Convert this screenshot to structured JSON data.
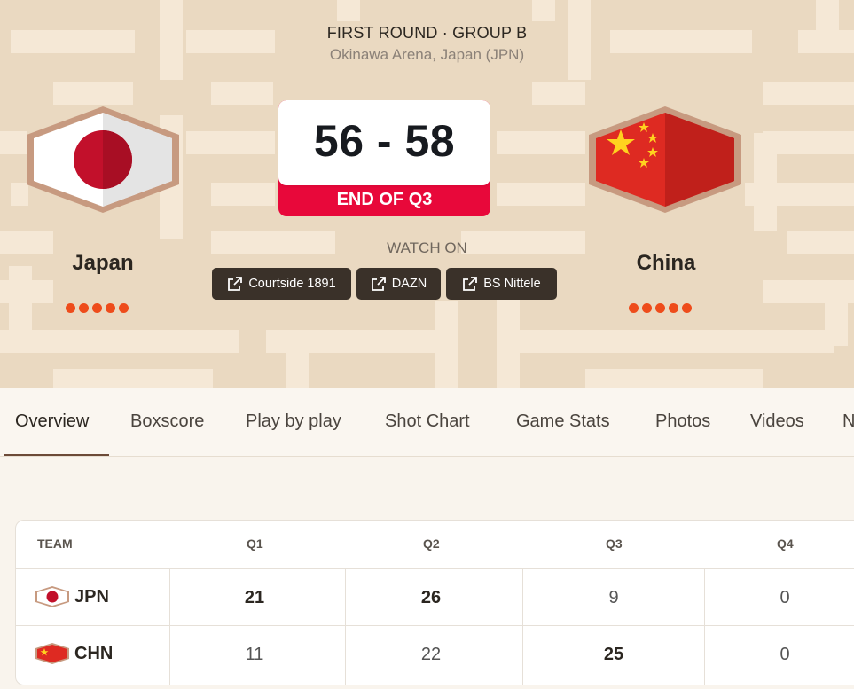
{
  "header": {
    "round": "FIRST ROUND · GROUP B",
    "venue": "Okinawa Arena, Japan (JPN)"
  },
  "score": {
    "display": "56 - 58",
    "status": "END OF Q3"
  },
  "watch": {
    "label": "WATCH ON",
    "providers": [
      "Courtside 1891",
      "DAZN",
      "BS Nittele"
    ]
  },
  "teams": {
    "home": {
      "name": "Japan",
      "code": "JPN",
      "flag": "japan-flag"
    },
    "away": {
      "name": "China",
      "code": "CHN",
      "flag": "china-flag"
    }
  },
  "tabs": [
    "Overview",
    "Boxscore",
    "Play by play",
    "Shot Chart",
    "Game Stats",
    "Photos",
    "Videos",
    "N"
  ],
  "active_tab": "Overview",
  "quarters": {
    "headers": [
      "TEAM",
      "Q1",
      "Q2",
      "Q3",
      "Q4"
    ],
    "rows": [
      {
        "team": "JPN",
        "scores": [
          "21",
          "26",
          "9",
          "0"
        ]
      },
      {
        "team": "CHN",
        "scores": [
          "11",
          "22",
          "25",
          "0"
        ]
      }
    ]
  },
  "colors": {
    "accent_red": "#e8083a",
    "dot_orange": "#ee4c1b",
    "button_dark": "#3a3129",
    "hero_bg": "#ead9c1"
  }
}
